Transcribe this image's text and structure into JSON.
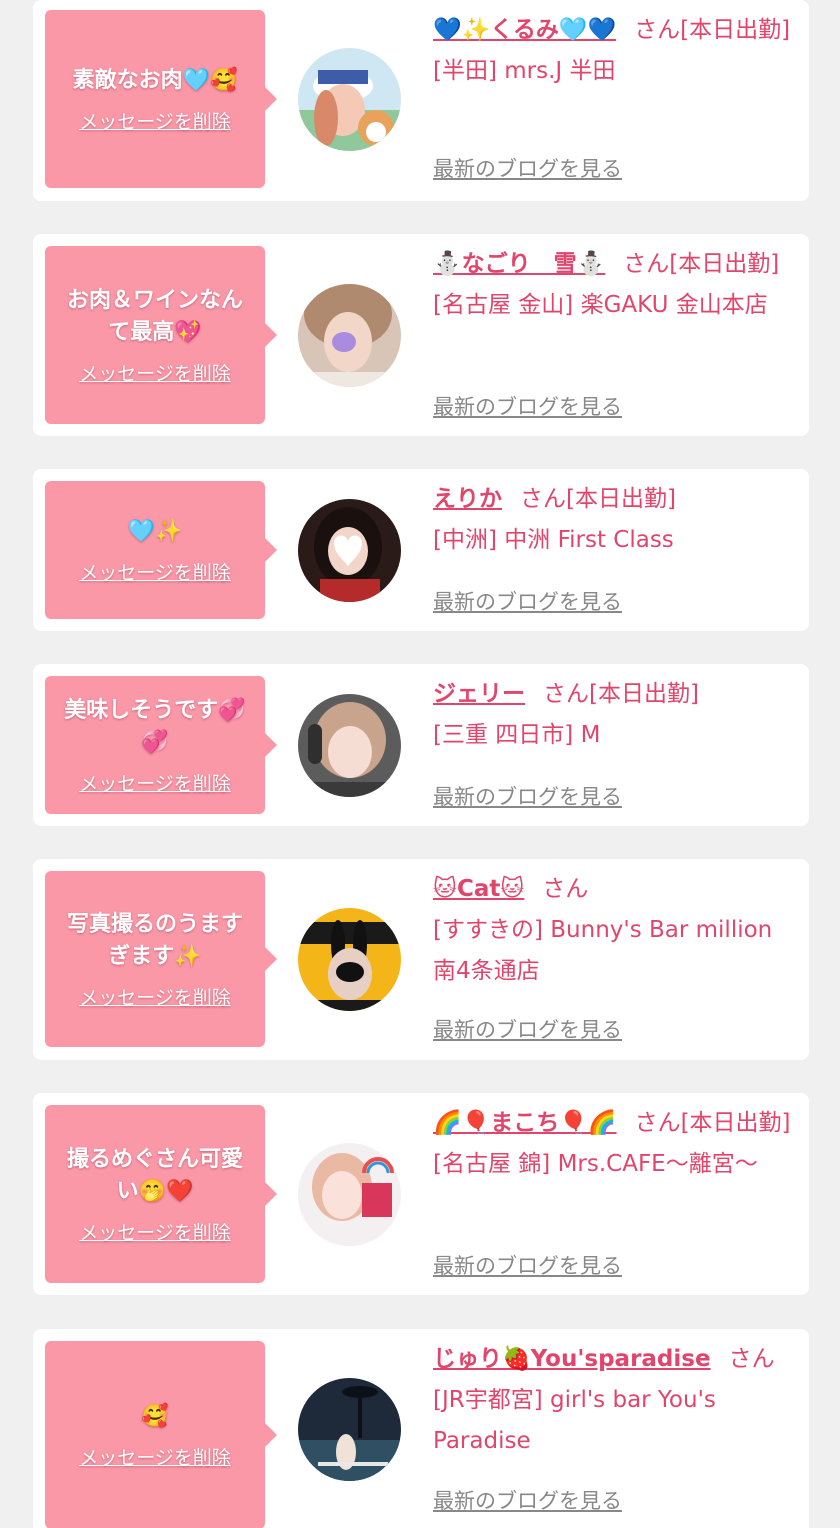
{
  "cards": [
    {
      "message": "素敵なお肉🩵🥰",
      "delete_label": "メッセージを削除",
      "name": "💙✨くるみ🩵💙",
      "suffix": "さん[本日出勤]",
      "shop": "[半田] mrs.J 半田",
      "blog_label": "最新のブログを見る"
    },
    {
      "message": "お肉＆ワインなんて最高💖",
      "delete_label": "メッセージを削除",
      "name": "⛄なごり　雪⛄",
      "suffix": "さん[本日出勤]",
      "shop": "[名古屋 金山] 楽GAKU 金山本店",
      "blog_label": "最新のブログを見る"
    },
    {
      "message": "🩵✨",
      "delete_label": "メッセージを削除",
      "name": "えりか",
      "suffix": "さん[本日出勤]",
      "shop": "[中洲] 中洲 First Class",
      "blog_label": "最新のブログを見る"
    },
    {
      "message": "美味しそうです💞💞",
      "delete_label": "メッセージを削除",
      "name": "ジェリー",
      "suffix": "さん[本日出勤]",
      "shop": "[三重 四日市] M",
      "blog_label": "最新のブログを見る"
    },
    {
      "message": "写真撮るのうますぎます✨",
      "delete_label": "メッセージを削除",
      "name": "🐱Cat🐱",
      "suffix": "さん",
      "shop": "[すすきの] Bunny's Bar million 南4条通店",
      "blog_label": "最新のブログを見る"
    },
    {
      "message": "撮るめぐさん可愛い🤭❤️",
      "delete_label": "メッセージを削除",
      "name": "🌈🎈まこち🎈🌈",
      "suffix": "さん[本日出勤]",
      "shop": "[名古屋 錦] Mrs.CAFE〜離宮〜",
      "blog_label": "最新のブログを見る"
    },
    {
      "message": "🥰",
      "delete_label": "メッセージを削除",
      "name": "じゅり🍓You'sparadise",
      "suffix": "さん",
      "shop": "[JR宇都宮] girl's bar You's Paradise",
      "blog_label": "最新のブログを見る"
    }
  ],
  "avatar_icons": [
    "avatar-icon",
    "avatar-icon",
    "avatar-icon",
    "avatar-icon",
    "avatar-icon",
    "avatar-icon",
    "avatar-icon"
  ],
  "colors": {
    "accent": "#e2456b",
    "bubble": "#fb98a8",
    "link_gray": "#888888",
    "page_bg": "#f0f0f0"
  }
}
